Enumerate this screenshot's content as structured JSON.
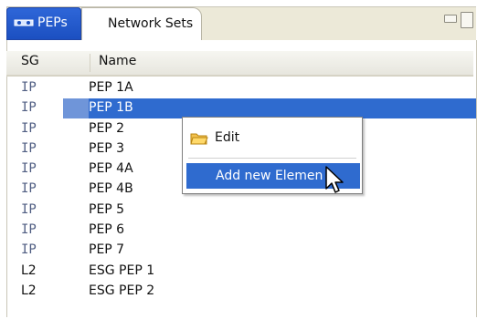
{
  "tabs": [
    {
      "label": "PEPs",
      "icon": "network-icon",
      "active": true
    },
    {
      "label": "Network Sets",
      "active": false
    }
  ],
  "columns": {
    "sg": "SG",
    "name": "Name"
  },
  "rows": [
    {
      "sg": "IP",
      "name": "PEP 1A",
      "selected": false
    },
    {
      "sg": "IP",
      "name": "PEP 1B",
      "selected": true
    },
    {
      "sg": "IP",
      "name": "PEP 2",
      "selected": false
    },
    {
      "sg": "IP",
      "name": "PEP 3",
      "selected": false
    },
    {
      "sg": "IP",
      "name": "PEP 4A",
      "selected": false
    },
    {
      "sg": "IP",
      "name": "PEP 4B",
      "selected": false
    },
    {
      "sg": "IP",
      "name": "PEP 5",
      "selected": false
    },
    {
      "sg": "IP",
      "name": "PEP 6",
      "selected": false
    },
    {
      "sg": "IP",
      "name": "PEP 7",
      "selected": false
    },
    {
      "sg": "L2",
      "name": "ESG PEP 1",
      "selected": false
    },
    {
      "sg": "L2",
      "name": "ESG PEP 2",
      "selected": false
    }
  ],
  "context_menu": {
    "edit_label": "Edit",
    "add_label": "Add new Elemen"
  },
  "colors": {
    "selection": "#2f6bcf",
    "tab_active": "#2f67d9"
  }
}
